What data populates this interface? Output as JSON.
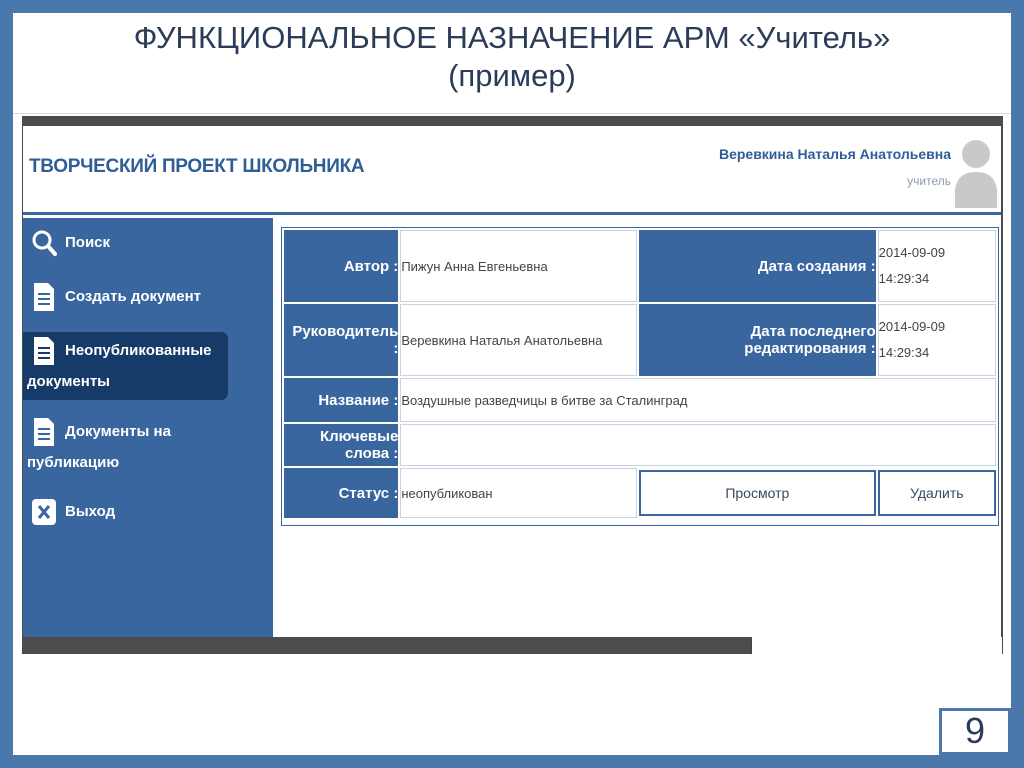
{
  "slide": {
    "title_line1": "ФУНКЦИОНАЛЬНОЕ НАЗНАЧЕНИЕ АРМ «Учитель»",
    "title_line2": "(пример)",
    "page_number": "9"
  },
  "app": {
    "title": "ТВОРЧЕСКИЙ ПРОЕКТ ШКОЛЬНИКА",
    "user_name": "Веревкина Наталья Анатольевна",
    "user_role": "учитель",
    "colors": {
      "primary": "#3a66a0",
      "active_nav": "#163b68",
      "frame": "#4a78ad",
      "title_text": "#2f5e97"
    }
  },
  "sidebar": {
    "items": [
      {
        "label": "Поиск",
        "icon": "search-icon"
      },
      {
        "label": "Создать документ",
        "icon": "document-icon"
      },
      {
        "label": "Неопубликованные документы",
        "icon": "document-icon"
      },
      {
        "label": "Документы на публикацию",
        "icon": "document-icon"
      },
      {
        "label": "Выход",
        "icon": "close-icon"
      }
    ],
    "active_index": 2
  },
  "details": {
    "author_label": "Автор :",
    "author_value": "Пижун Анна Евгеньевна",
    "created_label": "Дата создания :",
    "created_date": "2014-09-09",
    "created_time": "14:29:34",
    "supervisor_label": "Руководитель :",
    "supervisor_value": "Веревкина Наталья Анатольевна",
    "edited_label": "Дата последнего редактирования :",
    "edited_date": "2014-09-09",
    "edited_time": "14:29:34",
    "name_label": "Название :",
    "name_value": "Воздушные разведчицы в битве за Сталинград",
    "keywords_label": "Ключевые слова :",
    "keywords_value": "",
    "status_label": "Статус :",
    "status_value": "неопубликован",
    "view_button": "Просмотр",
    "delete_button": "Удалить"
  }
}
